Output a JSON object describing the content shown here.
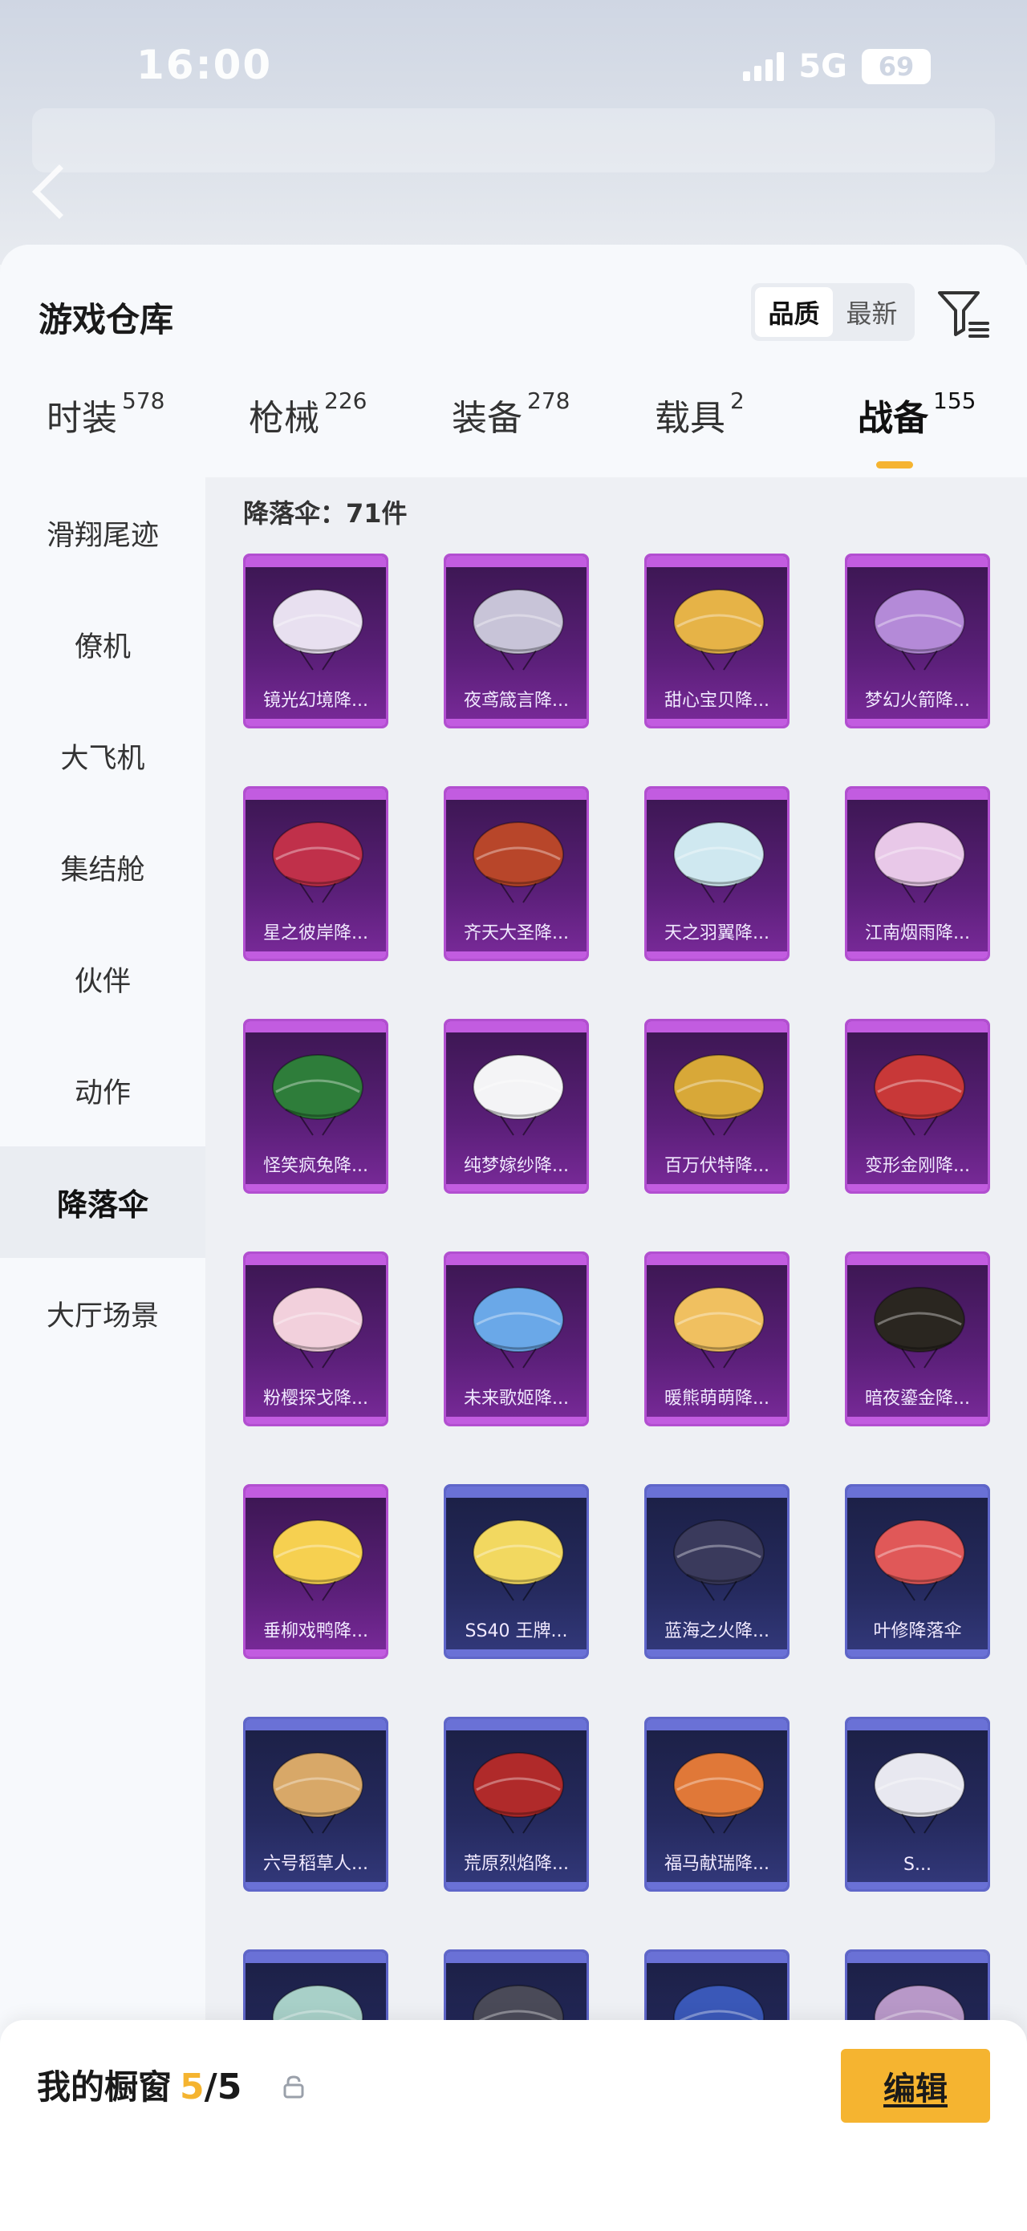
{
  "status_bar": {
    "time": "16:00",
    "network": "5G",
    "battery": "69"
  },
  "header": {
    "title": "游戏仓库",
    "sort_options": [
      "品质",
      "最新"
    ],
    "active_sort": 0
  },
  "tabs": [
    {
      "label": "时装",
      "count": "578"
    },
    {
      "label": "枪械",
      "count": "226"
    },
    {
      "label": "装备",
      "count": "278"
    },
    {
      "label": "载具",
      "count": "2"
    },
    {
      "label": "战备",
      "count": "155"
    }
  ],
  "sidebar": [
    {
      "label": "滑翔尾迹"
    },
    {
      "label": "僚机"
    },
    {
      "label": "大飞机"
    },
    {
      "label": "集结舱"
    },
    {
      "label": "伙伴"
    },
    {
      "label": "动作"
    },
    {
      "label": "降落伞"
    },
    {
      "label": "大厅场景"
    }
  ],
  "section": {
    "label": "降落伞：71件"
  },
  "items": [
    {
      "name": "镜光幻境降...",
      "rarity": "purple",
      "color": "#e8e0f0"
    },
    {
      "name": "夜鸢箴言降...",
      "rarity": "purple",
      "color": "#c8c4d8"
    },
    {
      "name": "甜心宝贝降...",
      "rarity": "purple",
      "color": "#e6b347"
    },
    {
      "name": "梦幻火箭降...",
      "rarity": "purple",
      "color": "#b48ad8"
    },
    {
      "name": "星之彼岸降...",
      "rarity": "purple",
      "color": "#c0304a"
    },
    {
      "name": "齐天大圣降...",
      "rarity": "purple",
      "color": "#b8462a"
    },
    {
      "name": "天之羽翼降...",
      "rarity": "purple",
      "color": "#cfe8f0"
    },
    {
      "name": "江南烟雨降...",
      "rarity": "purple",
      "color": "#e8c8e8"
    },
    {
      "name": "怪笑疯兔降...",
      "rarity": "purple",
      "color": "#2e7d3a"
    },
    {
      "name": "纯梦嫁纱降...",
      "rarity": "purple",
      "color": "#f4f4f6"
    },
    {
      "name": "百万伏特降...",
      "rarity": "purple",
      "color": "#d8a838"
    },
    {
      "name": "变形金刚降...",
      "rarity": "purple",
      "color": "#c83838"
    },
    {
      "name": "粉樱探戈降...",
      "rarity": "purple",
      "color": "#f2d0dc"
    },
    {
      "name": "未来歌姬降...",
      "rarity": "purple",
      "color": "#6aa8e8"
    },
    {
      "name": "暖熊萌萌降...",
      "rarity": "purple",
      "color": "#f0c060"
    },
    {
      "name": "暗夜鎏金降...",
      "rarity": "purple",
      "color": "#2a2620"
    },
    {
      "name": "垂柳戏鸭降...",
      "rarity": "purple",
      "color": "#f6d050"
    },
    {
      "name": "SS40 王牌...",
      "rarity": "blue",
      "color": "#f2d860"
    },
    {
      "name": "蓝海之火降...",
      "rarity": "blue",
      "color": "#3a3a5c"
    },
    {
      "name": "叶修降落伞",
      "rarity": "blue",
      "color": "#e05858"
    },
    {
      "name": "六号稻草人...",
      "rarity": "blue",
      "color": "#d8a868"
    },
    {
      "name": "荒原烈焰降...",
      "rarity": "blue",
      "color": "#b02a2a"
    },
    {
      "name": "福马献瑞降...",
      "rarity": "blue",
      "color": "#e07838"
    },
    {
      "name": "S...",
      "rarity": "blue",
      "color": "#e8e8f0"
    },
    {
      "name": "",
      "rarity": "blue",
      "color": "#a8d0c8"
    },
    {
      "name": "",
      "rarity": "blue",
      "color": "#4a4a58"
    },
    {
      "name": "",
      "rarity": "blue",
      "color": "#3a58b8"
    },
    {
      "name": "",
      "rarity": "blue",
      "color": "#b898c8"
    }
  ],
  "showcase": {
    "title": "我的橱窗",
    "current": "5",
    "total": "/5",
    "edit_label": "编辑"
  },
  "colors": {
    "accent": "#f5b430",
    "purple_frame": "#b24fd0",
    "blue_frame": "#5f66c9"
  }
}
